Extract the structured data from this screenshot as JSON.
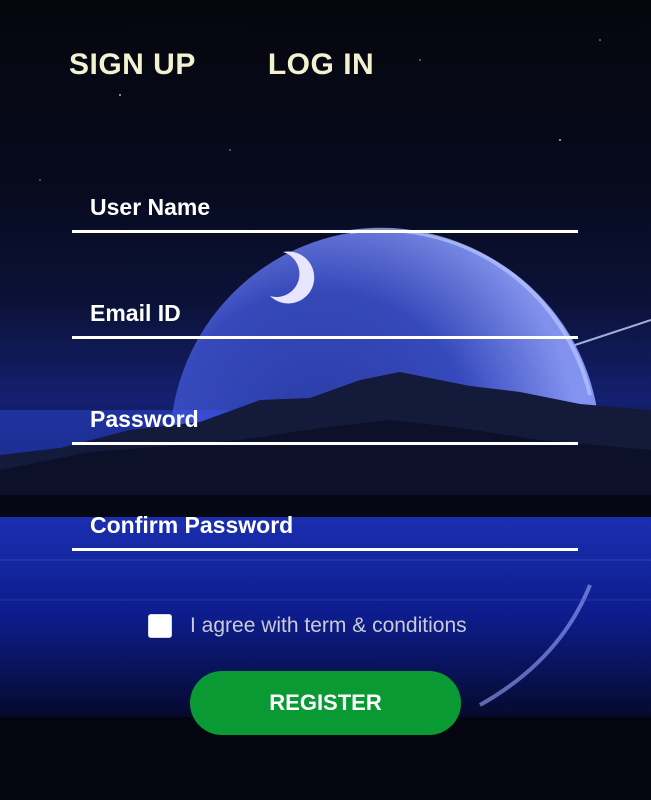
{
  "tabs": {
    "signup_label": "SIGN UP",
    "login_label": "LOG IN"
  },
  "form": {
    "username_placeholder": "User Name",
    "email_placeholder": "Email ID",
    "password_placeholder": "Password",
    "confirm_password_placeholder": "Confirm Password",
    "agree_label": "I agree with term & conditions",
    "agree_checked": false,
    "register_label": "REGISTER"
  },
  "colors": {
    "tab_text": "#f3f1cf",
    "field_underline": "#ffffff",
    "register_button": "#0a9a33",
    "background": "#05070f"
  }
}
